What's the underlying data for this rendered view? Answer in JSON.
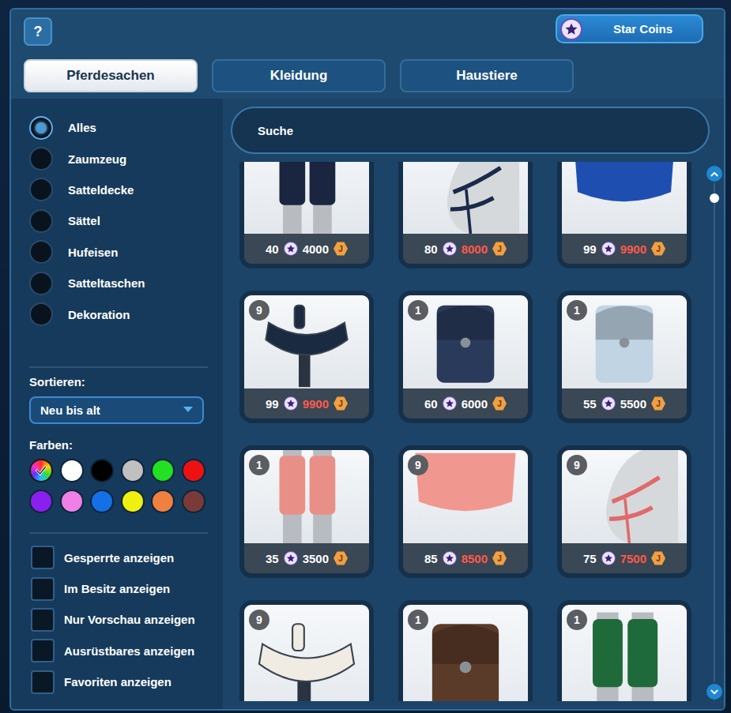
{
  "help_button": "?",
  "currency": {
    "star_coins_label": "Star Coins",
    "jorvik_symbol": "J"
  },
  "tabs": [
    {
      "label": "Pferdesachen",
      "selected": true
    },
    {
      "label": "Kleidung",
      "selected": false
    },
    {
      "label": "Haustiere",
      "selected": false
    }
  ],
  "search": {
    "placeholder": "Suche"
  },
  "categories": [
    {
      "label": "Alles",
      "selected": true
    },
    {
      "label": "Zaumzeug",
      "selected": false
    },
    {
      "label": "Satteldecke",
      "selected": false
    },
    {
      "label": "Sättel",
      "selected": false
    },
    {
      "label": "Hufeisen",
      "selected": false
    },
    {
      "label": "Satteltaschen",
      "selected": false
    },
    {
      "label": "Dekoration",
      "selected": false
    }
  ],
  "sort": {
    "label": "Sortieren:",
    "value": "Neu bis alt"
  },
  "colors": {
    "label": "Farben:",
    "swatches": [
      {
        "kind": "rainbow",
        "color": "#ffffff",
        "selected": true
      },
      {
        "kind": "solid",
        "color": "#ffffff",
        "selected": false
      },
      {
        "kind": "solid",
        "color": "#000000",
        "selected": false
      },
      {
        "kind": "solid",
        "color": "#c0c0c0",
        "selected": false
      },
      {
        "kind": "solid",
        "color": "#22e022",
        "selected": false
      },
      {
        "kind": "solid",
        "color": "#ee1111",
        "selected": false
      },
      {
        "kind": "solid",
        "color": "#8a1ff0",
        "selected": false
      },
      {
        "kind": "solid",
        "color": "#f080e8",
        "selected": false
      },
      {
        "kind": "solid",
        "color": "#1470e6",
        "selected": false
      },
      {
        "kind": "solid",
        "color": "#f0f010",
        "selected": false
      },
      {
        "kind": "solid",
        "color": "#f08040",
        "selected": false
      },
      {
        "kind": "solid",
        "color": "#7a3a38",
        "selected": false
      }
    ]
  },
  "filters": [
    {
      "label": "Gesperrte anzeigen",
      "checked": false
    },
    {
      "label": "Im Besitz anzeigen",
      "checked": false
    },
    {
      "label": "Nur Vorschau anzeigen",
      "checked": false
    },
    {
      "label": "Ausrüstbares anzeigen",
      "checked": false
    },
    {
      "label": "Favoriten anzeigen",
      "checked": false
    }
  ],
  "items": [
    {
      "kind": "boots",
      "color": "#1a2540",
      "star_coins": "40",
      "shillings": "4000",
      "affordable": true
    },
    {
      "kind": "halter",
      "color": "#1a2a4a",
      "star_coins": "80",
      "shillings": "8000",
      "affordable": false
    },
    {
      "kind": "blanket",
      "color": "#1e4fb0",
      "star_coins": "99",
      "shillings": "9900",
      "affordable": false
    },
    {
      "kind": "saddle",
      "color": "#1a2a40",
      "count": "9",
      "star_coins": "99",
      "shillings": "9900",
      "affordable": false
    },
    {
      "kind": "bag",
      "color": "#2a3a5a",
      "count": "1",
      "star_coins": "60",
      "shillings": "6000",
      "affordable": true
    },
    {
      "kind": "bag",
      "color": "#c0d4e4",
      "count": "1",
      "star_coins": "55",
      "shillings": "5500",
      "affordable": true
    },
    {
      "kind": "boots",
      "color": "#e89088",
      "count": "1",
      "star_coins": "35",
      "shillings": "3500",
      "affordable": true
    },
    {
      "kind": "blanket",
      "color": "#f09890",
      "count": "9",
      "star_coins": "85",
      "shillings": "8500",
      "affordable": false
    },
    {
      "kind": "halter",
      "color": "#e06a6a",
      "count": "9",
      "star_coins": "75",
      "shillings": "7500",
      "affordable": false
    },
    {
      "kind": "saddle",
      "color": "#f0ece4",
      "count": "9"
    },
    {
      "kind": "bag",
      "color": "#5a3a28",
      "count": "1"
    },
    {
      "kind": "boots",
      "color": "#1f6a3a",
      "count": "1"
    }
  ],
  "scrollbar": {
    "level": 0.02
  }
}
